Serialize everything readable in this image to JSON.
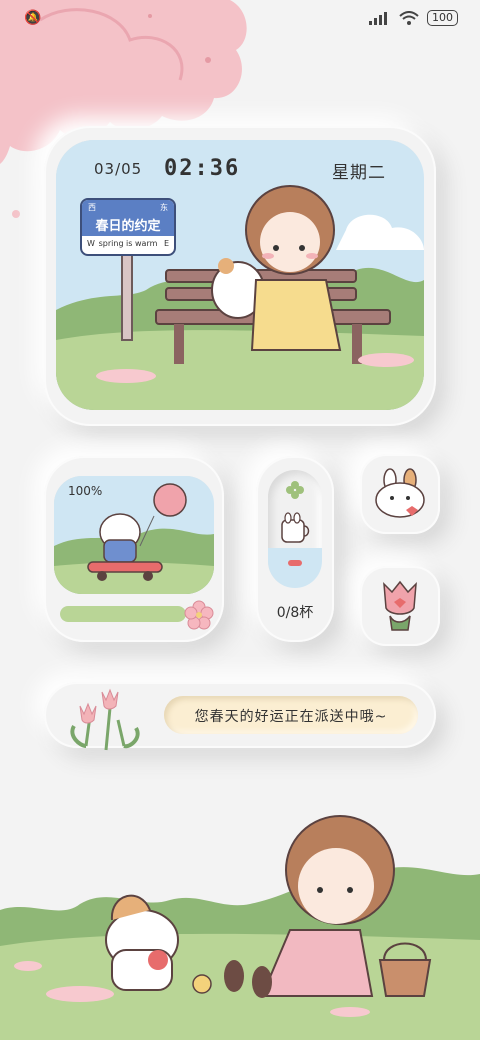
{
  "status_bar": {
    "left_icon": "notification-icon",
    "signal_icon": "signal-bars-icon",
    "wifi_icon": "wifi-icon",
    "battery": "100"
  },
  "main_widget": {
    "date": "03/05",
    "time": "02:36",
    "weekday": "星期二",
    "sign": {
      "west": "西",
      "east": "东",
      "title": "春日的约定",
      "w": "W",
      "e": "E",
      "subtitle": "spring is warm"
    }
  },
  "battery_widget": {
    "percent": "100%",
    "level": 1.0
  },
  "water_widget": {
    "count": "0/8杯"
  },
  "message_widget": {
    "text": "您春天的好运正在派送中哦~"
  },
  "colors": {
    "background": "#f3f3f3",
    "sky": "#cfe6f3",
    "grass": "#9fc17c",
    "blossom": "#f4c2c8",
    "message_bg": "#fbeed2"
  }
}
